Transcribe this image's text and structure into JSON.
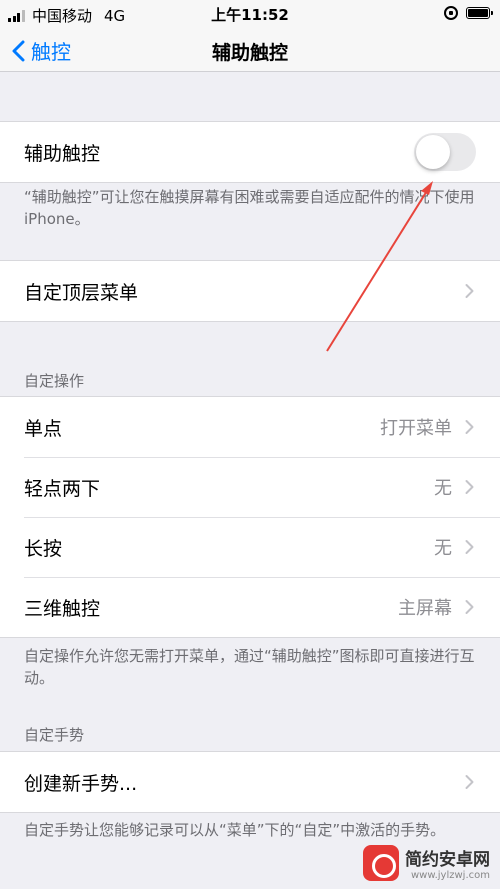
{
  "status_bar": {
    "carrier": "中国移动",
    "network": "4G",
    "time": "上午11:52"
  },
  "nav": {
    "back_label": "触控",
    "title": "辅助触控"
  },
  "assistive_touch": {
    "label": "辅助触控",
    "enabled": false,
    "footer": "“辅助触控”可让您在触摸屏幕有困难或需要自适应配件的情况下使用 iPhone。"
  },
  "top_menu": {
    "label": "自定顶层菜单"
  },
  "custom_actions": {
    "header": "自定操作",
    "items": [
      {
        "label": "单点",
        "value": "打开菜单"
      },
      {
        "label": "轻点两下",
        "value": "无"
      },
      {
        "label": "长按",
        "value": "无"
      },
      {
        "label": "三维触控",
        "value": "主屏幕"
      }
    ],
    "footer": "自定操作允许您无需打开菜单，通过“辅助触控”图标即可直接进行互动。"
  },
  "custom_gestures": {
    "header": "自定手势",
    "create_label": "创建新手势...",
    "footer": "自定手势让您能够记录可以从“菜单”下的“自定”中激活的手势。"
  },
  "watermark": {
    "name": "简约安卓网",
    "url": "www.jylzwj.com"
  },
  "colors": {
    "accent": "#007aff",
    "annotation": "#e8453c",
    "background": "#efeff4"
  }
}
